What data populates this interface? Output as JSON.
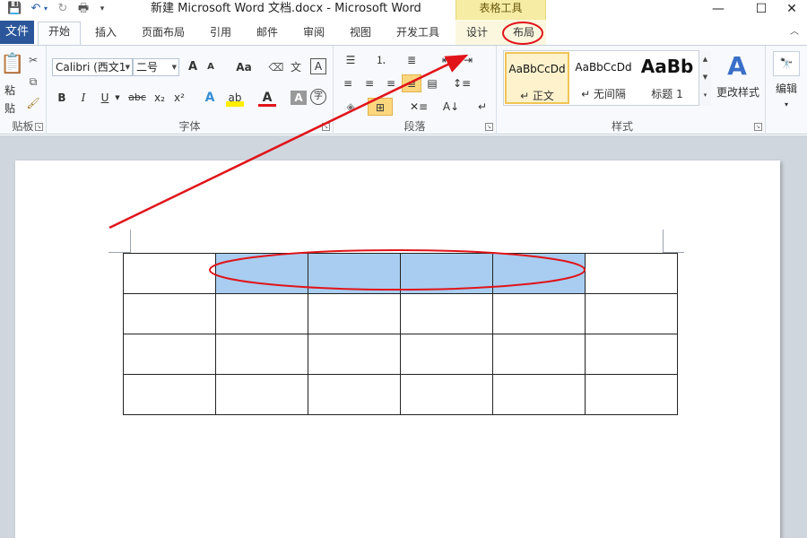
{
  "title_bar": {
    "title": "新建 Microsoft Word 文档.docx  -  Microsoft Word",
    "context_tab_group": "表格工具",
    "quick_access": [
      "save-icon",
      "undo-icon",
      "redo-icon",
      "print-icon",
      "customize-icon"
    ],
    "window_controls": {
      "minimize": "—",
      "maximize": "☐",
      "close": "✕"
    }
  },
  "tabs": {
    "file": "文件",
    "items": [
      "开始",
      "插入",
      "页面布局",
      "引用",
      "邮件",
      "审阅",
      "视图",
      "开发工具",
      "设计",
      "布局"
    ],
    "active": "开始"
  },
  "ribbon": {
    "clipboard": {
      "label": "贴板",
      "paste": "粘贴"
    },
    "font": {
      "label": "字体",
      "font_name": "Calibri (西文1",
      "font_size": "二号",
      "case_btn": "Aa",
      "bold": "B",
      "italic": "I",
      "underline": "U",
      "strike": "abc",
      "sub": "x₂",
      "sup": "x²",
      "font_color_letter": "A",
      "grow": "A",
      "shrink": "A",
      "clear": "A"
    },
    "paragraph": {
      "label": "段落"
    },
    "styles": {
      "label": "样式",
      "items": [
        {
          "sample": "AaBbCcDd",
          "name": "↵ 正文"
        },
        {
          "sample": "AaBbCcDd",
          "name": "↵ 无间隔"
        },
        {
          "sample": "AaBb",
          "name": "标题 1"
        }
      ],
      "change_styles": "更改样式"
    },
    "editing": {
      "label": "编辑"
    }
  },
  "document": {
    "table": {
      "rows": 4,
      "cols": 6,
      "highlighted_cells": [
        [
          0,
          1
        ],
        [
          0,
          2
        ],
        [
          0,
          3
        ],
        [
          0,
          4
        ]
      ]
    }
  },
  "colors": {
    "file_tab": "#2b579a",
    "context_band": "#f6eca3",
    "selection": "#a8cdf0",
    "annotation": "#e0141a"
  }
}
